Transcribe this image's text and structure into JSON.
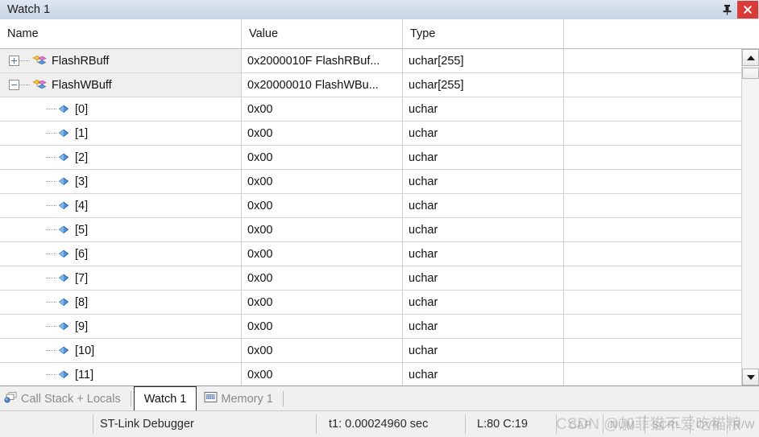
{
  "window": {
    "title": "Watch 1",
    "pin_icon": "pin-icon",
    "close_icon": "close-icon"
  },
  "grid": {
    "columns": [
      {
        "key": "name",
        "label": "Name"
      },
      {
        "key": "value",
        "label": "Value"
      },
      {
        "key": "type",
        "label": "Type"
      },
      {
        "key": "rest",
        "label": ""
      }
    ],
    "rows": [
      {
        "depth": 0,
        "expander": "plus",
        "icon": "array-icon",
        "name": "FlashRBuff",
        "value": "0x2000010F FlashRBuf...",
        "type": "uchar[255]"
      },
      {
        "depth": 0,
        "expander": "minus",
        "icon": "array-icon",
        "name": "FlashWBuff",
        "value": "0x20000010 FlashWBu...",
        "type": "uchar[255]"
      },
      {
        "depth": 1,
        "expander": "none",
        "icon": "diamond-icon",
        "name": "[0]",
        "value": "0x00",
        "type": "uchar"
      },
      {
        "depth": 1,
        "expander": "none",
        "icon": "diamond-icon",
        "name": "[1]",
        "value": "0x00",
        "type": "uchar"
      },
      {
        "depth": 1,
        "expander": "none",
        "icon": "diamond-icon",
        "name": "[2]",
        "value": "0x00",
        "type": "uchar"
      },
      {
        "depth": 1,
        "expander": "none",
        "icon": "diamond-icon",
        "name": "[3]",
        "value": "0x00",
        "type": "uchar"
      },
      {
        "depth": 1,
        "expander": "none",
        "icon": "diamond-icon",
        "name": "[4]",
        "value": "0x00",
        "type": "uchar"
      },
      {
        "depth": 1,
        "expander": "none",
        "icon": "diamond-icon",
        "name": "[5]",
        "value": "0x00",
        "type": "uchar"
      },
      {
        "depth": 1,
        "expander": "none",
        "icon": "diamond-icon",
        "name": "[6]",
        "value": "0x00",
        "type": "uchar"
      },
      {
        "depth": 1,
        "expander": "none",
        "icon": "diamond-icon",
        "name": "[7]",
        "value": "0x00",
        "type": "uchar"
      },
      {
        "depth": 1,
        "expander": "none",
        "icon": "diamond-icon",
        "name": "[8]",
        "value": "0x00",
        "type": "uchar"
      },
      {
        "depth": 1,
        "expander": "none",
        "icon": "diamond-icon",
        "name": "[9]",
        "value": "0x00",
        "type": "uchar"
      },
      {
        "depth": 1,
        "expander": "none",
        "icon": "diamond-icon",
        "name": "[10]",
        "value": "0x00",
        "type": "uchar"
      },
      {
        "depth": 1,
        "expander": "none",
        "icon": "diamond-icon",
        "name": "[11]",
        "value": "0x00",
        "type": "uchar"
      }
    ],
    "scrollbar": {
      "up_icon": "scroll-up-arrow-icon",
      "down_icon": "scroll-down-arrow-icon"
    }
  },
  "tabs": [
    {
      "label": "Call Stack + Locals",
      "icon": "call-stack-icon",
      "active": false
    },
    {
      "label": "Watch 1",
      "icon": "",
      "active": true
    },
    {
      "label": "Memory 1",
      "icon": "memory-icon",
      "active": false
    }
  ],
  "statusbar": {
    "debugger": "ST-Link Debugger",
    "time": "t1: 0.00024960 sec",
    "position": "L:80 C:19",
    "flags": [
      "CAP",
      "NUM",
      "SCRL",
      "OVR",
      "R/W"
    ]
  },
  "watermark": {
    "text": "CSDN @加菲猫不爱吃猫粮"
  },
  "colors": {
    "title_bar": "#d2ddea",
    "close_button": "#d93b37",
    "parent_row": "#efefef",
    "grid_line": "#d4d4d4"
  }
}
